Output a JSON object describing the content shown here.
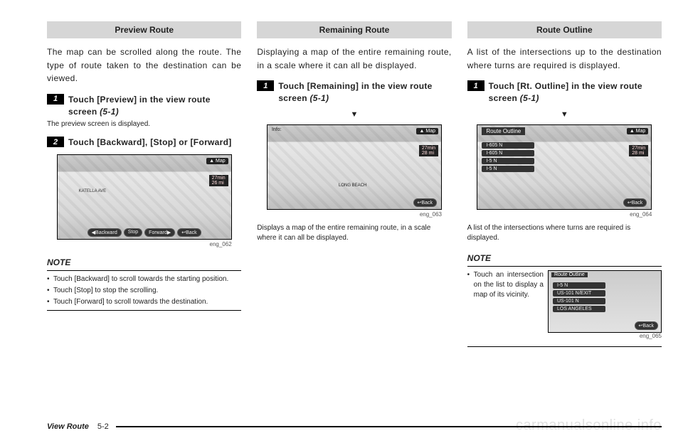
{
  "columns": [
    {
      "header": "Preview Route",
      "intro": "The map can be scrolled along the route. The type of route taken to the destination can be viewed.",
      "steps": [
        {
          "num": "1",
          "text": "Touch [Preview] in the view route screen ",
          "ref": "(5-1)",
          "sub": "The preview screen is displayed."
        },
        {
          "num": "2",
          "text": "Touch [Backward], [Stop] or [Forward]"
        }
      ],
      "screenshot": {
        "map_btn": "▲ Map",
        "info1": "27min",
        "info2": "  26 mi",
        "buttons": [
          "◀Backward",
          "Stop",
          "Forward▶",
          "↩Back"
        ],
        "label": "KATELLA AVE",
        "ref": "eng_062"
      },
      "note_header": "NOTE",
      "notes": [
        "Touch [Backward] to scroll towards the starting position.",
        "Touch [Stop] to stop the scrolling.",
        "Touch [Forward] to scroll towards the destination."
      ]
    },
    {
      "header": "Remaining Route",
      "intro": "Displaying a map of the entire remaining route, in a scale where it can all be displayed.",
      "steps": [
        {
          "num": "1",
          "text": "Touch [Remaining] in the view route screen ",
          "ref": "(5-1)"
        }
      ],
      "screenshot": {
        "map_btn": "▲ Map",
        "info1": "27min",
        "info2": "  28 mi",
        "buttons": [
          "↩Back"
        ],
        "label": "LONG BEACH",
        "top": "Info:",
        "ref": "eng_063"
      },
      "caption": "Displays a map of the entire remaining route, in a scale where it can all be displayed."
    },
    {
      "header": "Route Outline",
      "intro": "A list of the intersections up to the destination where turns are required is displayed.",
      "steps": [
        {
          "num": "1",
          "text": "Touch [Rt. Outline] in the view route screen ",
          "ref": "(5-1)"
        }
      ],
      "screenshot": {
        "map_btn": "▲ Map",
        "info1": "27min",
        "info2": "  28 mi",
        "buttons": [
          "↩Back"
        ],
        "title": "Route Outline",
        "list": [
          "I-605 N",
          "I-605 N",
          "I-5 N",
          "I-5 N"
        ],
        "ref": "eng_064"
      },
      "caption": "A list of the intersections where turns are required is displayed.",
      "note_header": "NOTE",
      "notes": [
        "Touch an intersection on the list to display a map of its vicinity."
      ],
      "mini": {
        "title": "Route Outline",
        "list": [
          "I-5 N",
          "US-101 N/EXIT",
          "US-101 N",
          "LOS ANGELES"
        ],
        "buttons": [
          "↩Back"
        ],
        "ref": "eng_065"
      }
    }
  ],
  "footer": {
    "section": "View Route",
    "page": "5-2"
  },
  "watermark": "carmanualsonline.info"
}
